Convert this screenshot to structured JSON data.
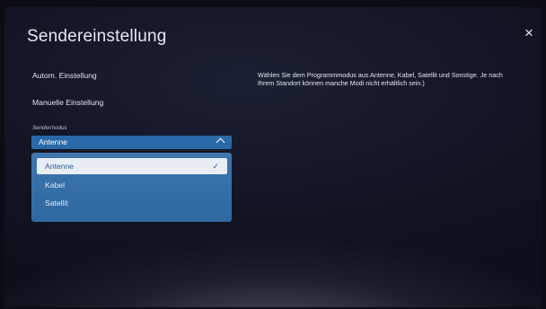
{
  "window": {
    "title": "Sendereinstellung",
    "close_label": "×"
  },
  "menu": {
    "auto": "Autom. Einstellung",
    "manual": "Manuelle Einstellung",
    "section_label": "Sendermodus"
  },
  "select": {
    "value": "Antenne",
    "options": [
      "Antenne",
      "Kabel",
      "Satellit"
    ],
    "selected_index": 0,
    "check": "✓"
  },
  "help": {
    "text": "Wählen Sie dem Programmmodus aus Antenne, Kabel, Satellit und Sonstige. Je nach Ihrem Standort können manche Modi nicht erhältlich sein.)"
  },
  "colors": {
    "select_bg": "#2a69a7",
    "dropdown_bg": "#3e76ae",
    "selected_bg": "#e9eef5",
    "selected_text": "#2e5f95"
  }
}
